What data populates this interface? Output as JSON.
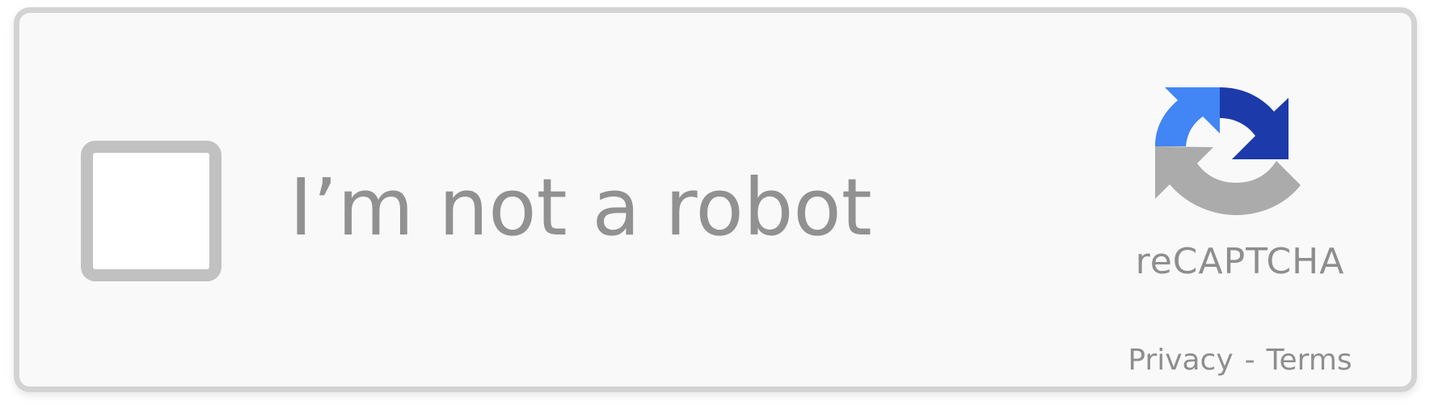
{
  "checkbox": {
    "label": "I’m not a robot",
    "checked": false
  },
  "brand": {
    "name": "reCAPTCHA",
    "icon": "recaptcha-logo-icon",
    "colors": {
      "light_blue": "#4285f4",
      "dark_blue": "#1c3aa9",
      "gray": "#ababab"
    }
  },
  "links": {
    "privacy": "Privacy",
    "separator": "-",
    "terms": "Terms"
  }
}
